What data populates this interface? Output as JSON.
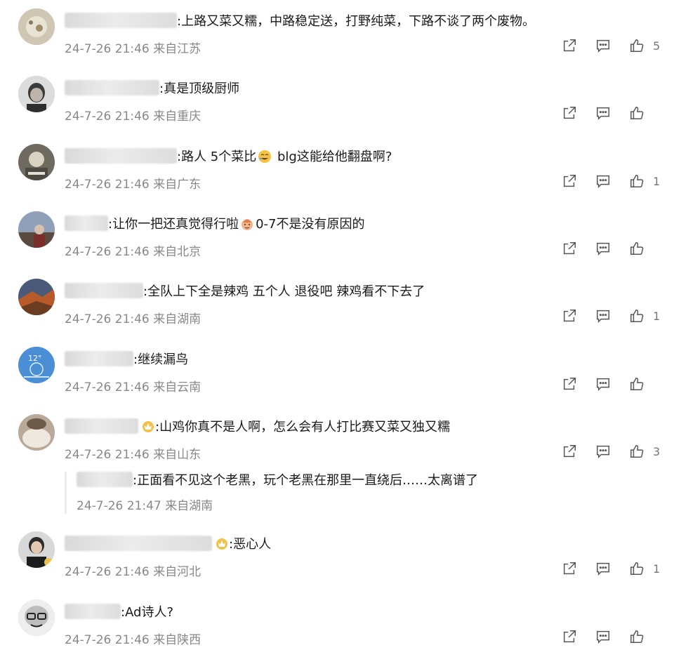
{
  "comments": [
    {
      "text": ":上路又菜又糯，中路稳定送，打野纯菜，下路不谈了两个废物。",
      "time": "24-7-26 21:46",
      "location": "来自江苏",
      "likes": "5"
    },
    {
      "text": ":真是顶级厨师",
      "time": "24-7-26 21:46",
      "location": "来自重庆",
      "likes": ""
    },
    {
      "text_a": ":路人  5个菜比",
      "text_b": " blg这能给他翻盘啊?",
      "time": "24-7-26 21:46",
      "location": "来自广东",
      "likes": "1"
    },
    {
      "text_a": ":让你一把还真觉得行啦",
      "text_b": "0-7不是没有原因的",
      "time": "24-7-26 21:46",
      "location": "来自北京",
      "likes": ""
    },
    {
      "text": ":全队上下全是辣鸡 五个人 退役吧  辣鸡看不下去了",
      "time": "24-7-26 21:46",
      "location": "来自湖南",
      "likes": "1"
    },
    {
      "text": ":继续漏鸟",
      "time": "24-7-26 21:46",
      "location": "来自云南",
      "likes": ""
    },
    {
      "text": ":山鸡你真不是人啊，怎么会有人打比赛又菜又独又糯",
      "time": "24-7-26 21:46",
      "location": "来自山东",
      "likes": "3",
      "reply": {
        "text": ":正面看不见这个老黑，玩个老黑在那里一直绕后……太离谱了",
        "time": "24-7-26 21:47",
        "location": "来自湖南"
      }
    },
    {
      "text": ":恶心人",
      "time": "24-7-26 21:46",
      "location": "来自河北",
      "likes": "1"
    },
    {
      "text": ":Ad诗人?",
      "time": "24-7-26 21:46",
      "location": "来自陕西",
      "likes": ""
    }
  ],
  "avatar_text": {
    "weather_temp": "12°"
  },
  "icons": {
    "share": "share-icon",
    "comment": "comment-icon",
    "like": "like-icon",
    "badge": "crown-badge-icon"
  },
  "colors": {
    "text": "#1a1a1a",
    "meta": "#888888",
    "icon": "#555555",
    "reply_border": "#ebebeb"
  }
}
